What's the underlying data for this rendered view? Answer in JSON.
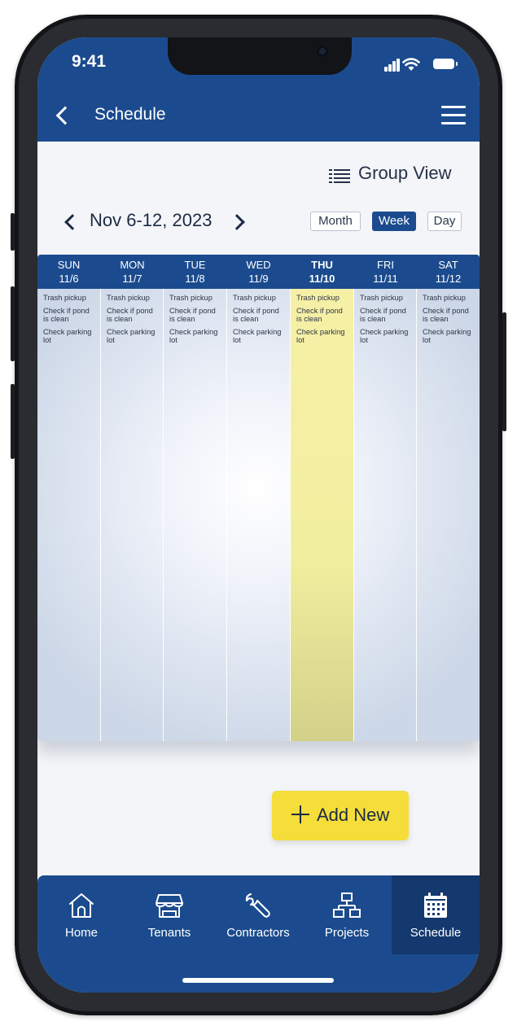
{
  "status_bar": {
    "time": "9:41"
  },
  "header": {
    "title": "Schedule",
    "back_icon": "chevron-left-icon",
    "menu_icon": "hamburger-menu-icon"
  },
  "toolbar": {
    "group_view_label": "Group View",
    "group_view_icon": "list-icon"
  },
  "week_nav": {
    "range": "Nov 6-12, 2023",
    "views": [
      "Month",
      "Week",
      "Day"
    ],
    "selected_view": "Week"
  },
  "calendar": {
    "days": [
      {
        "name": "SUN",
        "date": "11/6",
        "tasks": [
          "Trash pickup",
          "Check if pond is clean",
          "Check parking lot"
        ]
      },
      {
        "name": "MON",
        "date": "11/7",
        "tasks": [
          "Trash pickup",
          "Check if pond is clean",
          "Check parking lot"
        ]
      },
      {
        "name": "TUE",
        "date": "11/8",
        "tasks": [
          "Trash pickup",
          "Check if pond is clean",
          "Check parking lot"
        ]
      },
      {
        "name": "WED",
        "date": "11/9",
        "tasks": [
          "Trash pickup",
          "Check if pond is clean",
          "Check parking lot"
        ]
      },
      {
        "name": "THU",
        "date": "11/10",
        "tasks": [
          "Trash pickup",
          "Check if pond is clean",
          "Check parking lot"
        ]
      },
      {
        "name": "FRI",
        "date": "11/11",
        "tasks": [
          "Trash pickup",
          "Check if pond is clean",
          "Check parking lot"
        ]
      },
      {
        "name": "SAT",
        "date": "11/12",
        "tasks": [
          "Trash pickup",
          "Check if pond is clean",
          "Check parking lot"
        ]
      }
    ],
    "highlighted_day": "THU"
  },
  "add_new": {
    "label": "Add New",
    "icon": "plus-icon"
  },
  "bottom_nav": {
    "items": [
      {
        "label": "Home",
        "icon": "home-icon"
      },
      {
        "label": "Tenants",
        "icon": "storefront-icon"
      },
      {
        "label": "Contractors",
        "icon": "wrench-icon"
      },
      {
        "label": "Projects",
        "icon": "org-chart-icon"
      },
      {
        "label": "Schedule",
        "icon": "calendar-icon"
      }
    ],
    "active": "Schedule"
  },
  "colors": {
    "primary": "#1b4b8e",
    "active_tab": "#13396e",
    "accent_yellow": "#f5dd3a",
    "today_highlight": "#f2ee9f",
    "background": "#f4f5f8"
  }
}
